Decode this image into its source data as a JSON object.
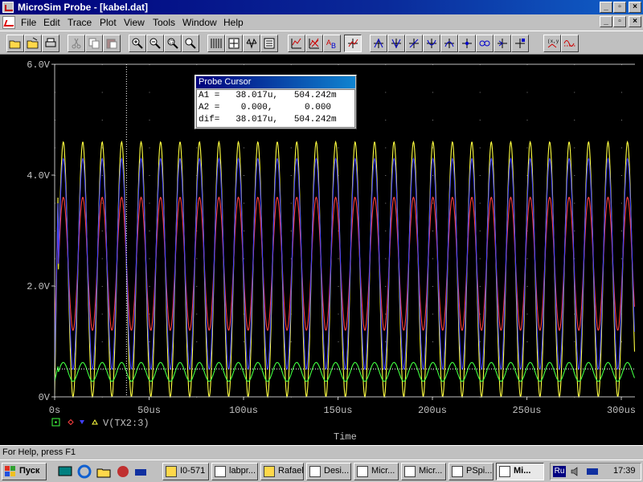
{
  "window": {
    "title": "MicroSim Probe - [kabel.dat]",
    "min_glyph": "_",
    "max_glyph": "▫",
    "close_glyph": "×"
  },
  "menu": {
    "items": [
      "File",
      "Edit",
      "Trace",
      "Plot",
      "View",
      "Tools",
      "Window",
      "Help"
    ]
  },
  "toolbar": {
    "icons": [
      "open-folder-icon",
      "open-file-icon",
      "print-icon",
      "cut-icon",
      "copy-icon",
      "paste-icon",
      "zoom-in-icon",
      "zoom-out-icon",
      "zoom-area-icon",
      "zoom-fit-icon",
      "log-x-icon",
      "fourier-icon",
      "performance-icon",
      "eval-icon",
      "add-trace-icon",
      "delete-trace-icon",
      "mark-label-icon",
      "cursor-toggle-icon",
      "cursor-peak-icon",
      "cursor-trough-icon",
      "cursor-slope-icon",
      "cursor-min-icon",
      "cursor-max-icon",
      "cursor-point-icon",
      "cursor-search-icon",
      "cursor-next-icon",
      "mark-data-icon",
      "waveform-icon"
    ]
  },
  "cursor_box": {
    "title": "Probe Cursor",
    "row_a1": "A1 =   38.017u,   504.242m",
    "row_a2": "A2 =    0.000,      0.000",
    "row_dif": "dif=   38.017u,   504.242m"
  },
  "plot": {
    "legend_label": "V(TX2:3)",
    "x_title": "Time",
    "y_ticks": [
      "6.0V",
      "4.0V",
      "2.0V",
      "0V"
    ],
    "x_ticks": [
      "0s",
      "50us",
      "100us",
      "150us",
      "200us",
      "250us",
      "300us"
    ]
  },
  "chart_data": {
    "type": "line",
    "xlabel": "Time",
    "ylabel": "",
    "xlim": [
      0,
      310
    ],
    "ylim": [
      0,
      6
    ],
    "x_unit": "us",
    "y_unit": "V",
    "cursor_x": 38.017,
    "cursor_y": 0.504,
    "series": [
      {
        "color": "#ffff40",
        "amplitude": 2.3,
        "offset": 2.3,
        "period_us": 10.3,
        "peak": 4.55,
        "trough": 0.05
      },
      {
        "color": "#ff4040",
        "amplitude": 1.2,
        "offset": 2.4,
        "period_us": 10.3,
        "peak": 3.6,
        "trough": 1.2
      },
      {
        "color": "#4040ff",
        "amplitude": 1.9,
        "offset": 2.4,
        "period_us": 10.3,
        "peak": 4.3,
        "trough": 0.5
      },
      {
        "color": "#40ff40",
        "amplitude": 0.17,
        "offset": 0.45,
        "period_us": 10.3,
        "peak": 0.62,
        "trough": 0.28
      }
    ]
  },
  "statusbar": {
    "text": "For Help, press F1"
  },
  "taskbar": {
    "start_label": "Пуск",
    "tasks": [
      "I0-571",
      "labpr...",
      "Rafael",
      "Desi...",
      "Micr...",
      "Micr...",
      "PSpi...",
      "Mi..."
    ],
    "lang": "Ru",
    "clock": "17:39"
  }
}
